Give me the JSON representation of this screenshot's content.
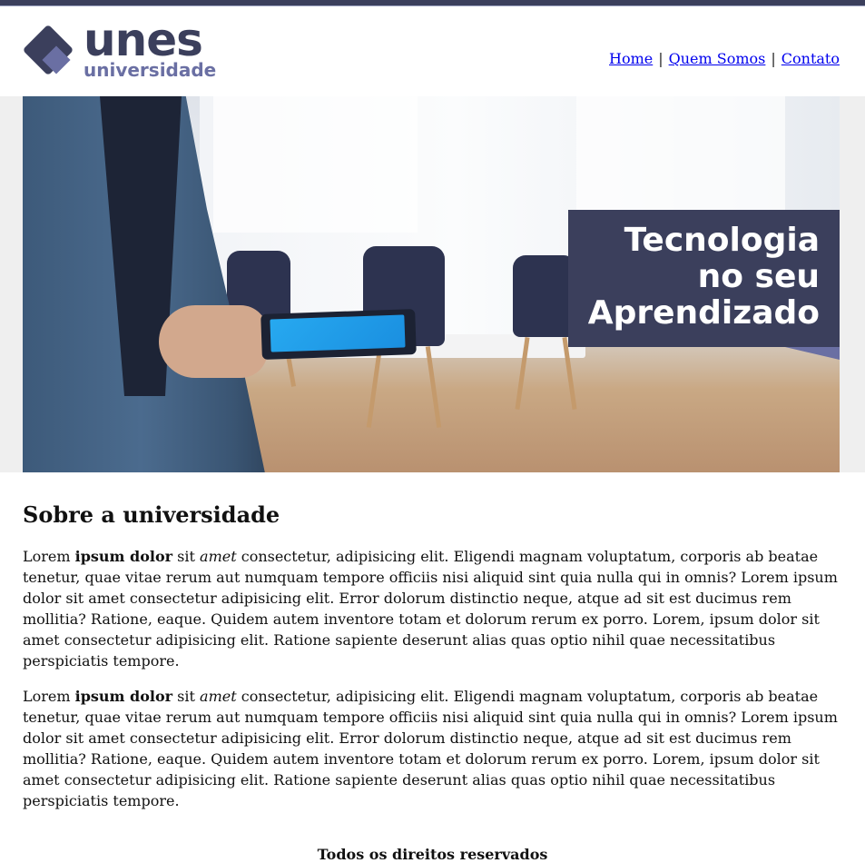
{
  "header": {
    "logo_word": "unes",
    "logo_sub": "universidade",
    "nav": [
      {
        "label": "Home"
      },
      {
        "label": "Quem Somos"
      },
      {
        "label": "Contato"
      }
    ],
    "nav_separator": "|"
  },
  "banner": {
    "tagline_line1": "Tecnologia",
    "tagline_line2": "no seu",
    "tagline_line3": "Aprendizado"
  },
  "main": {
    "heading": "Sobre a universidade",
    "paragraphs": [
      {
        "lead": "Lorem ",
        "bold": "ipsum dolor",
        "mid": " sit ",
        "italic": "amet",
        "rest": " consectetur, adipisicing elit. Eligendi magnam voluptatum, corporis ab beatae tenetur, quae vitae rerum aut numquam tempore officiis nisi aliquid sint quia nulla qui in omnis? Lorem ipsum dolor sit amet consectetur adipisicing elit. Error dolorum distinctio neque, atque ad sit est ducimus rem mollitia? Ratione, eaque. Quidem autem inventore totam et dolorum rerum ex porro. Lorem, ipsum dolor sit amet consectetur adipisicing elit. Ratione sapiente deserunt alias quas optio nihil quae necessitatibus perspiciatis tempore."
      },
      {
        "lead": "Lorem ",
        "bold": "ipsum dolor",
        "mid": " sit ",
        "italic": "amet",
        "rest": " consectetur, adipisicing elit. Eligendi magnam voluptatum, corporis ab beatae tenetur, quae vitae rerum aut numquam tempore officiis nisi aliquid sint quia nulla qui in omnis? Lorem ipsum dolor sit amet consectetur adipisicing elit. Error dolorum distinctio neque, atque ad sit est ducimus rem mollitia? Ratione, eaque. Quidem autem inventore totam et dolorum rerum ex porro. Lorem, ipsum dolor sit amet consectetur adipisicing elit. Ratione sapiente deserunt alias quas optio nihil quae necessitatibus perspiciatis tempore."
      }
    ]
  },
  "footer": {
    "text": "Todos os direitos reservados"
  },
  "colors": {
    "brand_dark": "#3b3f5c",
    "brand_light": "#6a6fa3",
    "link": "#0000ee"
  }
}
